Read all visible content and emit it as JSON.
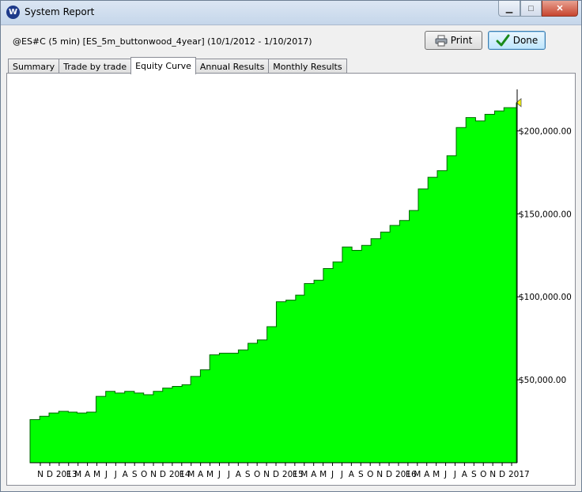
{
  "window": {
    "title": "System Report",
    "app_icon_letter": "W",
    "min_glyph": "▁",
    "max_glyph": "□",
    "close_glyph": "✕"
  },
  "report": {
    "label": "@ES#C (5 min) [ES_5m_buttonwood_4year]  (10/1/2012 - 1/10/2017)"
  },
  "buttons": {
    "print_label": "Print",
    "done_label": "Done"
  },
  "tabs": [
    {
      "label": "Summary",
      "active": false
    },
    {
      "label": "Trade by trade",
      "active": false
    },
    {
      "label": "Equity Curve",
      "active": true
    },
    {
      "label": "Annual Results",
      "active": false
    },
    {
      "label": "Monthly Results",
      "active": false
    }
  ],
  "colors": {
    "fill": "#00ff00",
    "line": "#006400",
    "marker": "#ffff00"
  },
  "chart_data": {
    "type": "area",
    "title": "",
    "xlabel": "",
    "ylabel": "",
    "ylim": [
      0,
      225000
    ],
    "y_ticks": [
      {
        "value": 50000,
        "label": "$50,000.00"
      },
      {
        "value": 100000,
        "label": "$100,000.00"
      },
      {
        "value": 150000,
        "label": "$150,000.00"
      },
      {
        "value": 200000,
        "label": "$200,000.00"
      }
    ],
    "x_ticks": [
      "N",
      "D",
      "2013",
      "F",
      "M",
      "A",
      "M",
      "J",
      "J",
      "A",
      "S",
      "O",
      "N",
      "D",
      "2014",
      "F",
      "M",
      "A",
      "M",
      "J",
      "J",
      "A",
      "S",
      "O",
      "N",
      "D",
      "2015",
      "F",
      "M",
      "A",
      "M",
      "J",
      "J",
      "A",
      "S",
      "O",
      "N",
      "D",
      "2016",
      "F",
      "M",
      "A",
      "M",
      "J",
      "J",
      "A",
      "S",
      "O",
      "N",
      "D",
      "2017"
    ],
    "x_range": [
      "2012-10-01",
      "2017-01-10"
    ],
    "series": [
      {
        "x": [
          "2012-10-01",
          "2012-11-01",
          "2012-12-01",
          "2013-01-01",
          "2013-02-01",
          "2013-03-01",
          "2013-04-01",
          "2013-05-01",
          "2013-06-01",
          "2013-07-01",
          "2013-08-01",
          "2013-09-01",
          "2013-10-01",
          "2013-11-01",
          "2013-12-01",
          "2014-01-01",
          "2014-02-01",
          "2014-03-01",
          "2014-04-01",
          "2014-05-01",
          "2014-06-01",
          "2014-07-01",
          "2014-08-01",
          "2014-09-01",
          "2014-10-01",
          "2014-11-01",
          "2014-12-01",
          "2015-01-01",
          "2015-02-01",
          "2015-03-01",
          "2015-04-01",
          "2015-05-01",
          "2015-06-01",
          "2015-07-01",
          "2015-08-01",
          "2015-09-01",
          "2015-10-01",
          "2015-11-01",
          "2015-12-01",
          "2016-01-01",
          "2016-02-01",
          "2016-03-01",
          "2016-04-01",
          "2016-05-01",
          "2016-06-01",
          "2016-07-01",
          "2016-08-01",
          "2016-09-01",
          "2016-10-01",
          "2016-11-01",
          "2016-12-01",
          "2017-01-10"
        ],
        "values": [
          26000,
          28000,
          30000,
          31000,
          30500,
          30000,
          30500,
          40000,
          43000,
          42000,
          43000,
          42000,
          41000,
          43000,
          45000,
          46000,
          47000,
          52000,
          56000,
          65000,
          66000,
          66000,
          68000,
          72000,
          74000,
          82000,
          97000,
          98000,
          101000,
          108000,
          110000,
          117000,
          121000,
          130000,
          128000,
          131000,
          135000,
          139000,
          143000,
          146000,
          152000,
          165000,
          172000,
          176000,
          185000,
          202000,
          208000,
          206000,
          210000,
          212000,
          214000,
          217000
        ]
      }
    ]
  }
}
